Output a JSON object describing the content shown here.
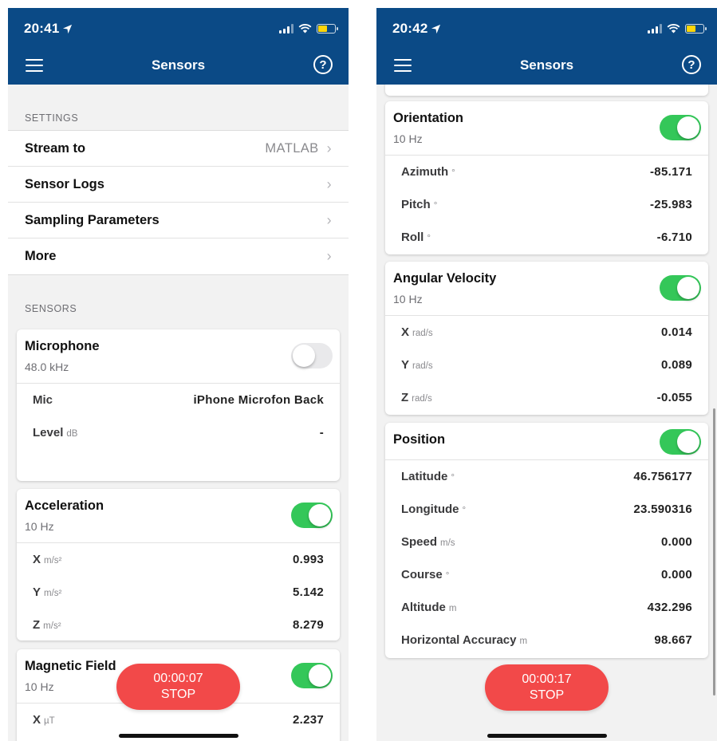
{
  "left": {
    "status": {
      "time": "20:41"
    },
    "header": {
      "title": "Sensors",
      "help_symbol": "?"
    },
    "settings_header": "SETTINGS",
    "settings_items": [
      {
        "label": "Stream to",
        "value": "MATLAB"
      },
      {
        "label": "Sensor Logs",
        "value": ""
      },
      {
        "label": "Sampling Parameters",
        "value": ""
      },
      {
        "label": "More",
        "value": ""
      }
    ],
    "sensors_header": "SENSORS",
    "microphone": {
      "title": "Microphone",
      "rate": "48.0 kHz",
      "enabled": false,
      "rows": [
        {
          "label": "Mic",
          "unit": "",
          "value": "iPhone Microfon Back"
        },
        {
          "label": "Level",
          "unit": "dB",
          "value": "-"
        }
      ]
    },
    "acceleration": {
      "title": "Acceleration",
      "rate": "10 Hz",
      "enabled": true,
      "rows": [
        {
          "label": "X",
          "unit": "m/s²",
          "value": "0.993"
        },
        {
          "label": "Y",
          "unit": "m/s²",
          "value": "5.142"
        },
        {
          "label": "Z",
          "unit": "m/s²",
          "value": "8.279"
        }
      ]
    },
    "magnetic": {
      "title": "Magnetic Field",
      "rate": "10 Hz",
      "enabled": true,
      "rows": [
        {
          "label": "X",
          "unit": "µT",
          "value": "2.237"
        }
      ]
    },
    "stop": {
      "time": "00:00:07",
      "label": "STOP"
    }
  },
  "right": {
    "status": {
      "time": "20:42"
    },
    "header": {
      "title": "Sensors",
      "help_symbol": "?"
    },
    "orientation": {
      "title": "Orientation",
      "rate": "10 Hz",
      "enabled": true,
      "rows": [
        {
          "label": "Azimuth",
          "unit": "°",
          "value": "-85.171"
        },
        {
          "label": "Pitch",
          "unit": "°",
          "value": "-25.983"
        },
        {
          "label": "Roll",
          "unit": "°",
          "value": "-6.710"
        }
      ]
    },
    "angular": {
      "title": "Angular Velocity",
      "rate": "10 Hz",
      "enabled": true,
      "rows": [
        {
          "label": "X",
          "unit": "rad/s",
          "value": "0.014"
        },
        {
          "label": "Y",
          "unit": "rad/s",
          "value": "0.089"
        },
        {
          "label": "Z",
          "unit": "rad/s",
          "value": "-0.055"
        }
      ]
    },
    "position": {
      "title": "Position",
      "enabled": true,
      "rows": [
        {
          "label": "Latitude",
          "unit": "°",
          "value": "46.756177"
        },
        {
          "label": "Longitude",
          "unit": "°",
          "value": "23.590316"
        },
        {
          "label": "Speed",
          "unit": "m/s",
          "value": "0.000"
        },
        {
          "label": "Course",
          "unit": "°",
          "value": "0.000"
        },
        {
          "label": "Altitude",
          "unit": "m",
          "value": "432.296"
        },
        {
          "label": "Horizontal Accuracy",
          "unit": "m",
          "value": "98.667"
        }
      ]
    },
    "stop": {
      "time": "00:00:17",
      "label": "STOP"
    }
  },
  "colors": {
    "header_bg": "#0b4a86",
    "toggle_on": "#34c759",
    "toggle_off": "#e9e9eb",
    "stop_button": "#f24949",
    "battery": "#ffd60a"
  },
  "icons": {
    "menu": "hamburger-menu-icon",
    "help": "question-circle-icon",
    "chevron": "chevron-right-icon",
    "location": "location-arrow-icon",
    "signal": "cellular-signal-icon",
    "wifi": "wifi-icon",
    "battery": "battery-icon"
  }
}
